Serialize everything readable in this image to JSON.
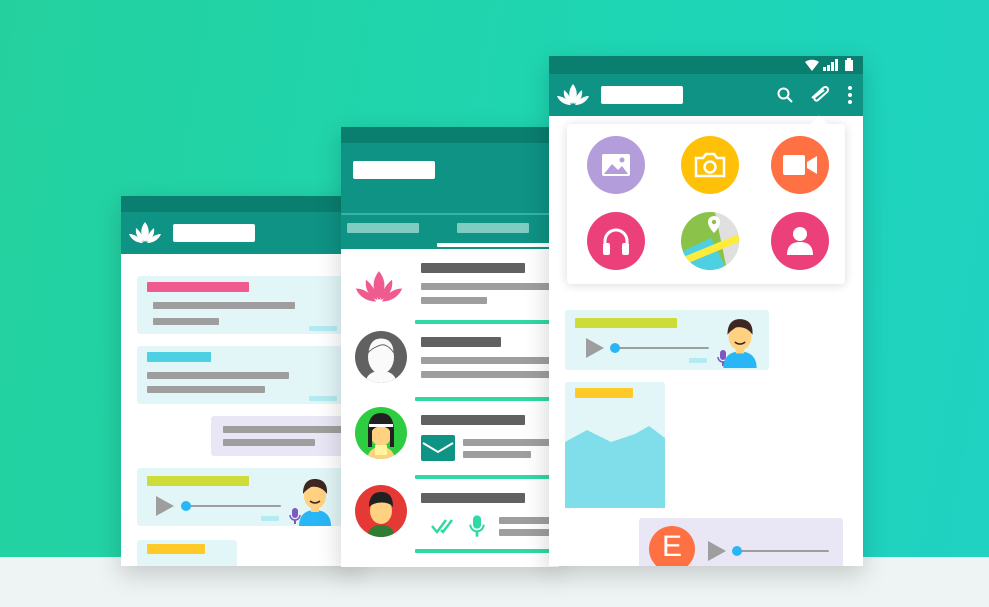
{
  "colors": {
    "background": "#22d3ad",
    "floor": "#eef4f3",
    "status_bar": "#0a7e6f",
    "app_bar": "#0e9384",
    "accent": "#2ed9a4",
    "pink": "#ef5b8e",
    "cyan": "#4dd0e1",
    "lime": "#cddc39",
    "yellow": "#ffc928",
    "sent_bubble": "#e9e6f5",
    "received_bubble": "#e2f6f8",
    "attach_gallery": "#b39ddb",
    "attach_camera": "#ffc107",
    "attach_video": "#ff7043",
    "attach_audio": "#ec407a",
    "attach_location": "#8bc34a",
    "attach_contact": "#ec407a"
  },
  "icons": {
    "app_logo": "lotus-icon",
    "search": "search-icon",
    "attach": "paperclip-icon",
    "menu": "more-vert-icon",
    "wifi": "wifi-icon",
    "signal": "signal-icon",
    "battery": "battery-icon",
    "attach_options": [
      "gallery-icon",
      "camera-icon",
      "video-icon",
      "headphones-icon",
      "location-icon",
      "contact-icon"
    ]
  },
  "left_phone": {
    "messages": [
      "received-pink",
      "received-cyan",
      "sent",
      "voice-note",
      "received-yellow"
    ]
  },
  "middle_phone": {
    "tabs": 2,
    "active_tab": 1,
    "chats": [
      "lotus-avatar",
      "grey-avatar",
      "green-avatar",
      "red-avatar"
    ]
  },
  "right_phone": {
    "attachment_menu_open": true,
    "voice_progress": 0.0,
    "sender_initial": "E"
  }
}
